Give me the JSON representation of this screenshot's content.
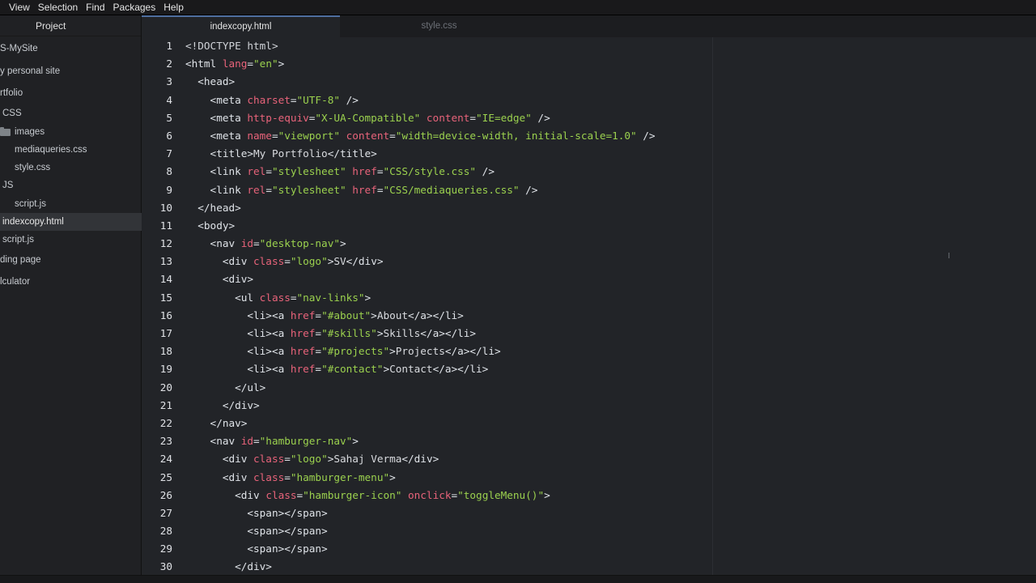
{
  "menu": [
    "View",
    "Selection",
    "Find",
    "Packages",
    "Help"
  ],
  "sidebar": {
    "title": "Project",
    "items": [
      {
        "label": "S-MySite",
        "indent": 0,
        "icon": "",
        "selected": false
      },
      {
        "label": "y personal site",
        "indent": 0,
        "icon": "",
        "selected": false
      },
      {
        "label": "rtfolio",
        "indent": 0,
        "icon": "",
        "selected": false
      },
      {
        "label": "CSS",
        "indent": 3,
        "icon": "",
        "selected": false
      },
      {
        "label": "images",
        "indent": 0,
        "icon": "folder-icon",
        "selected": false
      },
      {
        "label": "mediaqueries.css",
        "indent": 18,
        "icon": "",
        "selected": false
      },
      {
        "label": "style.css",
        "indent": 18,
        "icon": "",
        "selected": false
      },
      {
        "label": "JS",
        "indent": 3,
        "icon": "",
        "selected": false
      },
      {
        "label": "script.js",
        "indent": 18,
        "icon": "",
        "selected": false
      },
      {
        "label": "indexcopy.html",
        "indent": 3,
        "icon": "",
        "selected": true
      },
      {
        "label": "script.js",
        "indent": 3,
        "icon": "",
        "selected": false
      },
      {
        "label": "ding page",
        "indent": 0,
        "icon": "",
        "selected": false
      },
      {
        "label": "lculator",
        "indent": 0,
        "icon": "",
        "selected": false
      }
    ]
  },
  "tabs": [
    {
      "label": "indexcopy.html",
      "active": true
    },
    {
      "label": "style.css",
      "active": false
    }
  ],
  "editor": {
    "lines": [
      {
        "n": "1",
        "t": [
          [
            "doc",
            "<!DOCTYPE html>"
          ]
        ]
      },
      {
        "n": "2",
        "t": [
          [
            "tag",
            "<html "
          ],
          [
            "attr",
            "lang"
          ],
          [
            "tag",
            "="
          ],
          [
            "str",
            "\"en\""
          ],
          [
            "tag",
            ">"
          ]
        ]
      },
      {
        "n": "3",
        "t": [
          [
            "tag",
            "  <head>"
          ]
        ]
      },
      {
        "n": "4",
        "t": [
          [
            "tag",
            "    <meta "
          ],
          [
            "attr",
            "charset"
          ],
          [
            "tag",
            "="
          ],
          [
            "str",
            "\"UTF-8\""
          ],
          [
            "tag",
            " />"
          ]
        ]
      },
      {
        "n": "5",
        "t": [
          [
            "tag",
            "    <meta "
          ],
          [
            "attr",
            "http-equiv"
          ],
          [
            "tag",
            "="
          ],
          [
            "str",
            "\"X-UA-Compatible\""
          ],
          [
            "tag",
            " "
          ],
          [
            "attr",
            "content"
          ],
          [
            "tag",
            "="
          ],
          [
            "str",
            "\"IE=edge\""
          ],
          [
            "tag",
            " />"
          ]
        ]
      },
      {
        "n": "6",
        "t": [
          [
            "tag",
            "    <meta "
          ],
          [
            "attr",
            "name"
          ],
          [
            "tag",
            "="
          ],
          [
            "str",
            "\"viewport\""
          ],
          [
            "tag",
            " "
          ],
          [
            "attr",
            "content"
          ],
          [
            "tag",
            "="
          ],
          [
            "str",
            "\"width=device-width, initial-scale=1.0\""
          ],
          [
            "tag",
            " />"
          ]
        ]
      },
      {
        "n": "7",
        "t": [
          [
            "tag",
            "    <title>"
          ],
          [
            "txt",
            "My Portfolio"
          ],
          [
            "tag",
            "</title>"
          ]
        ]
      },
      {
        "n": "8",
        "t": [
          [
            "tag",
            "    <link "
          ],
          [
            "attr",
            "rel"
          ],
          [
            "tag",
            "="
          ],
          [
            "str",
            "\"stylesheet\""
          ],
          [
            "tag",
            " "
          ],
          [
            "attr",
            "href"
          ],
          [
            "tag",
            "="
          ],
          [
            "str",
            "\"CSS/style.css\""
          ],
          [
            "tag",
            " />"
          ]
        ]
      },
      {
        "n": "9",
        "t": [
          [
            "tag",
            "    <link "
          ],
          [
            "attr",
            "rel"
          ],
          [
            "tag",
            "="
          ],
          [
            "str",
            "\"stylesheet\""
          ],
          [
            "tag",
            " "
          ],
          [
            "attr",
            "href"
          ],
          [
            "tag",
            "="
          ],
          [
            "str",
            "\"CSS/mediaqueries.css\""
          ],
          [
            "tag",
            " />"
          ]
        ]
      },
      {
        "n": "10",
        "t": [
          [
            "tag",
            "  </head>"
          ]
        ]
      },
      {
        "n": "11",
        "t": [
          [
            "tag",
            "  <body>"
          ]
        ]
      },
      {
        "n": "12",
        "t": [
          [
            "tag",
            "    <nav "
          ],
          [
            "attr",
            "id"
          ],
          [
            "tag",
            "="
          ],
          [
            "str",
            "\"desktop-nav\""
          ],
          [
            "tag",
            ">"
          ]
        ]
      },
      {
        "n": "13",
        "t": [
          [
            "tag",
            "      <div "
          ],
          [
            "attr",
            "class"
          ],
          [
            "tag",
            "="
          ],
          [
            "str",
            "\"logo\""
          ],
          [
            "tag",
            ">"
          ],
          [
            "txt",
            "SV"
          ],
          [
            "tag",
            "</div>"
          ]
        ]
      },
      {
        "n": "14",
        "t": [
          [
            "tag",
            "      <div>"
          ]
        ]
      },
      {
        "n": "15",
        "t": [
          [
            "tag",
            "        <ul "
          ],
          [
            "attr",
            "class"
          ],
          [
            "tag",
            "="
          ],
          [
            "str",
            "\"nav-links\""
          ],
          [
            "tag",
            ">"
          ]
        ]
      },
      {
        "n": "16",
        "t": [
          [
            "tag",
            "          <li><a "
          ],
          [
            "attr",
            "href"
          ],
          [
            "tag",
            "="
          ],
          [
            "str",
            "\"#about\""
          ],
          [
            "tag",
            ">"
          ],
          [
            "txt",
            "About"
          ],
          [
            "tag",
            "</a></li>"
          ]
        ]
      },
      {
        "n": "17",
        "t": [
          [
            "tag",
            "          <li><a "
          ],
          [
            "attr",
            "href"
          ],
          [
            "tag",
            "="
          ],
          [
            "str",
            "\"#skills\""
          ],
          [
            "tag",
            ">"
          ],
          [
            "txt",
            "Skills"
          ],
          [
            "tag",
            "</a></li>"
          ]
        ]
      },
      {
        "n": "18",
        "t": [
          [
            "tag",
            "          <li><a "
          ],
          [
            "attr",
            "href"
          ],
          [
            "tag",
            "="
          ],
          [
            "str",
            "\"#projects\""
          ],
          [
            "tag",
            ">"
          ],
          [
            "txt",
            "Projects"
          ],
          [
            "tag",
            "</a></li>"
          ]
        ]
      },
      {
        "n": "19",
        "t": [
          [
            "tag",
            "          <li><a "
          ],
          [
            "attr",
            "href"
          ],
          [
            "tag",
            "="
          ],
          [
            "str",
            "\"#contact\""
          ],
          [
            "tag",
            ">"
          ],
          [
            "txt",
            "Contact"
          ],
          [
            "tag",
            "</a></li>"
          ]
        ]
      },
      {
        "n": "20",
        "t": [
          [
            "tag",
            "        </ul>"
          ]
        ]
      },
      {
        "n": "21",
        "t": [
          [
            "tag",
            "      </div>"
          ]
        ]
      },
      {
        "n": "22",
        "t": [
          [
            "tag",
            "    </nav>"
          ]
        ]
      },
      {
        "n": "23",
        "t": [
          [
            "tag",
            "    <nav "
          ],
          [
            "attr",
            "id"
          ],
          [
            "tag",
            "="
          ],
          [
            "str",
            "\"hamburger-nav\""
          ],
          [
            "tag",
            ">"
          ]
        ]
      },
      {
        "n": "24",
        "t": [
          [
            "tag",
            "      <div "
          ],
          [
            "attr",
            "class"
          ],
          [
            "tag",
            "="
          ],
          [
            "str",
            "\"logo\""
          ],
          [
            "tag",
            ">"
          ],
          [
            "txt",
            "Sahaj Verma"
          ],
          [
            "tag",
            "</div>"
          ]
        ]
      },
      {
        "n": "25",
        "t": [
          [
            "tag",
            "      <div "
          ],
          [
            "attr",
            "class"
          ],
          [
            "tag",
            "="
          ],
          [
            "str",
            "\"hamburger-menu\""
          ],
          [
            "tag",
            ">"
          ]
        ]
      },
      {
        "n": "26",
        "t": [
          [
            "tag",
            "        <div "
          ],
          [
            "attr",
            "class"
          ],
          [
            "tag",
            "="
          ],
          [
            "str",
            "\"hamburger-icon\""
          ],
          [
            "tag",
            " "
          ],
          [
            "attr",
            "onclick"
          ],
          [
            "tag",
            "="
          ],
          [
            "str",
            "\"toggleMenu()\""
          ],
          [
            "tag",
            ">"
          ]
        ]
      },
      {
        "n": "27",
        "t": [
          [
            "tag",
            "          <span></span>"
          ]
        ]
      },
      {
        "n": "28",
        "t": [
          [
            "tag",
            "          <span></span>"
          ]
        ]
      },
      {
        "n": "29",
        "t": [
          [
            "tag",
            "          <span></span>"
          ]
        ]
      },
      {
        "n": "30",
        "t": [
          [
            "tag",
            "        </div>"
          ]
        ]
      }
    ]
  },
  "colors": {
    "tag": "#dfe3e8",
    "attribute": "#e8637a",
    "string": "#9bd14e",
    "text": "#d9dbdf",
    "background": "#222428"
  }
}
